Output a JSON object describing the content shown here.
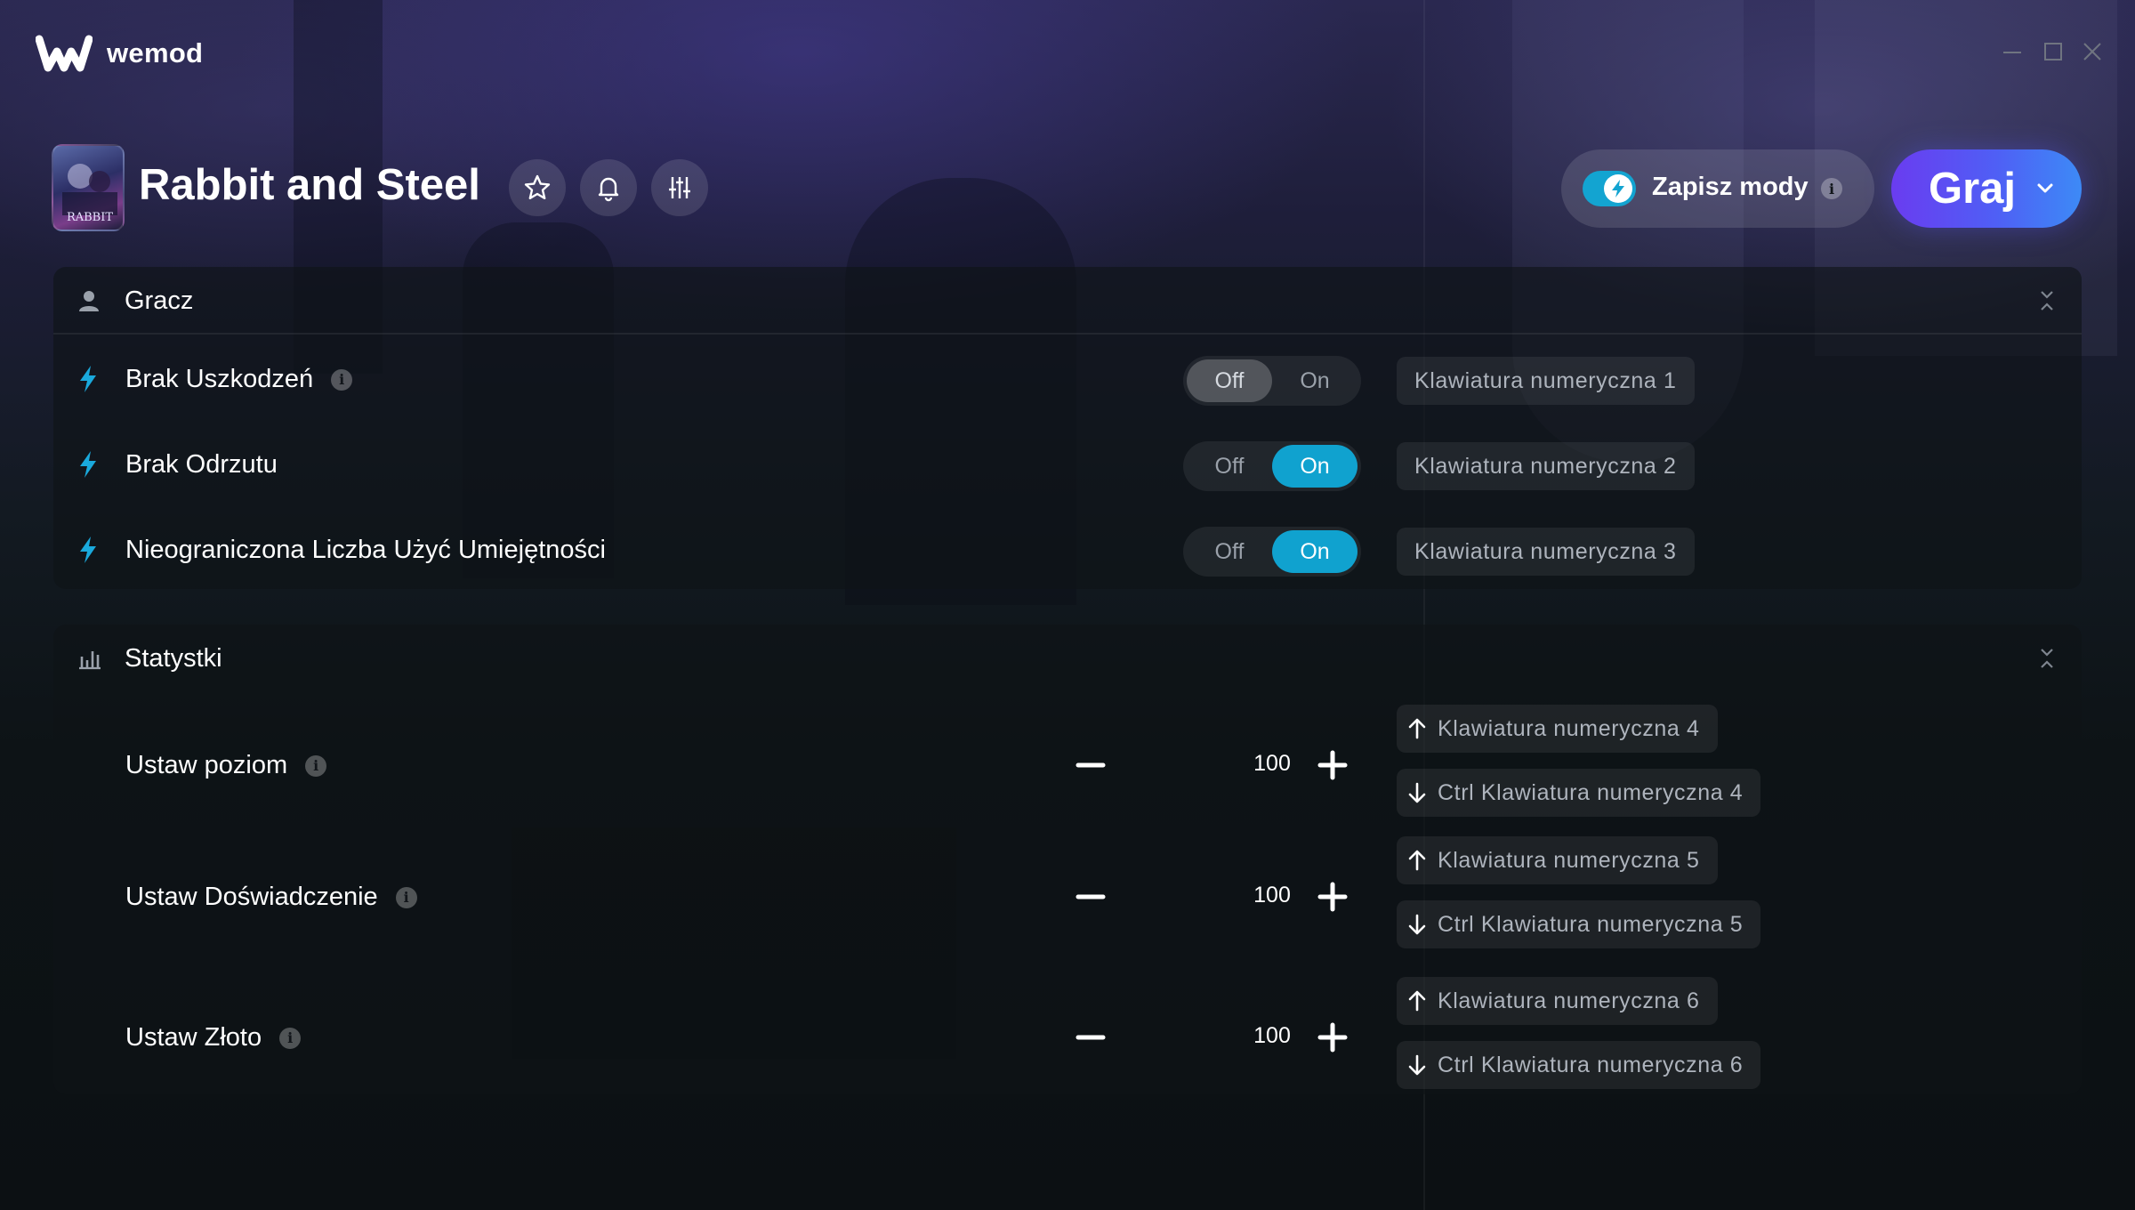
{
  "app": {
    "brand": "wemod"
  },
  "game": {
    "title": "Rabbit and Steel",
    "thumb_caption": "RABBIT"
  },
  "header": {
    "save_mods_label": "Zapisz mody",
    "play_label": "Graj"
  },
  "sections": {
    "player": {
      "title": "Gracz",
      "mods": [
        {
          "name": "Brak Uszkodzeń",
          "has_info": true,
          "state": "Off",
          "hotkey": "Klawiatura numeryczna 1"
        },
        {
          "name": "Brak Odrzutu",
          "has_info": false,
          "state": "On",
          "hotkey": "Klawiatura numeryczna 2"
        },
        {
          "name": "Nieograniczona Liczba Użyć Umiejętności",
          "has_info": false,
          "state": "On",
          "hotkey": "Klawiatura numeryczna 3"
        }
      ],
      "switch_labels": {
        "off": "Off",
        "on": "On"
      }
    },
    "stats": {
      "title": "Statystki",
      "mods": [
        {
          "name": "Ustaw poziom",
          "value": "100",
          "hotkey_up": "Klawiatura numeryczna 4",
          "hotkey_down": "Ctrl Klawiatura numeryczna 4"
        },
        {
          "name": "Ustaw Doświadczenie",
          "value": "100",
          "hotkey_up": "Klawiatura numeryczna 5",
          "hotkey_down": "Ctrl Klawiatura numeryczna 5"
        },
        {
          "name": "Ustaw Złoto",
          "value": "100",
          "hotkey_up": "Klawiatura numeryczna 6",
          "hotkey_down": "Ctrl Klawiatura numeryczna 6"
        }
      ]
    }
  },
  "colors": {
    "accent_cyan": "#10a2cf",
    "play_gradient_start": "#6a3cf0",
    "play_gradient_end": "#3d8af6"
  },
  "icons": [
    "wemod-logo-icon",
    "minimize-icon",
    "maximize-icon",
    "close-icon",
    "star-icon",
    "bell-icon",
    "sliders-icon",
    "bolt-icon",
    "user-icon",
    "bar-chart-icon",
    "collapse-icon",
    "info-icon",
    "chevron-down-icon",
    "minus-icon",
    "plus-icon",
    "arrow-up-icon",
    "arrow-down-icon"
  ]
}
